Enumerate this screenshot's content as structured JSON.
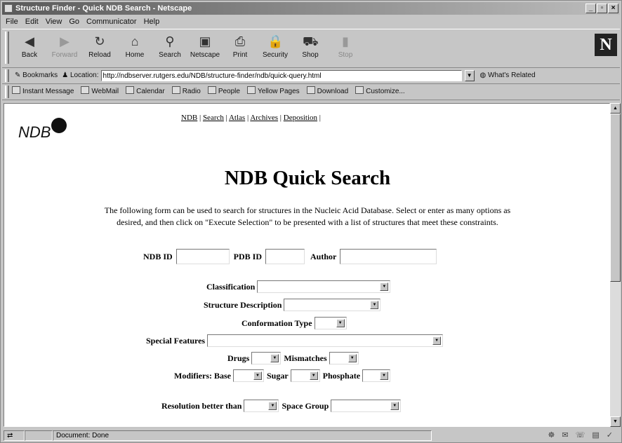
{
  "window": {
    "title": "Structure Finder - Quick NDB Search - Netscape",
    "controls": [
      "_",
      "▫",
      "×"
    ]
  },
  "menu": [
    "File",
    "Edit",
    "View",
    "Go",
    "Communicator",
    "Help"
  ],
  "toolbar": [
    {
      "label": "Back",
      "icon": "back-arrow-icon",
      "glyph": "◀",
      "enabled": true
    },
    {
      "label": "Forward",
      "icon": "forward-arrow-icon",
      "glyph": "▶",
      "enabled": false
    },
    {
      "label": "Reload",
      "icon": "reload-icon",
      "glyph": "↻",
      "enabled": true
    },
    {
      "label": "Home",
      "icon": "home-icon",
      "glyph": "⌂",
      "enabled": true
    },
    {
      "label": "Search",
      "icon": "search-icon",
      "glyph": "⚲",
      "enabled": true
    },
    {
      "label": "Netscape",
      "icon": "netscape-icon",
      "glyph": "▣",
      "enabled": true
    },
    {
      "label": "Print",
      "icon": "print-icon",
      "glyph": "⎙",
      "enabled": true
    },
    {
      "label": "Security",
      "icon": "lock-icon",
      "glyph": "🔒",
      "enabled": true
    },
    {
      "label": "Shop",
      "icon": "shop-icon",
      "glyph": "⛟",
      "enabled": true
    },
    {
      "label": "Stop",
      "icon": "stop-icon",
      "glyph": "▮",
      "enabled": false
    }
  ],
  "brand_logo": "N",
  "location": {
    "bookmarks_label": "Bookmarks",
    "label": "Location:",
    "url": "http://ndbserver.rutgers.edu/NDB/structure-finder/ndb/quick-query.html",
    "related_label": "What's Related"
  },
  "personal_toolbar": [
    "Instant Message",
    "WebMail",
    "Calendar",
    "Radio",
    "People",
    "Yellow Pages",
    "Download",
    "Customize..."
  ],
  "page": {
    "logo_text": "NDB",
    "nav": [
      "NDB",
      "Search",
      "Atlas",
      "Archives",
      "Deposition"
    ],
    "heading": "NDB Quick Search",
    "intro_1": "The following form can be used to search for structures in the Nucleic Acid Database. Select or enter as many options as",
    "intro_2": "desired, and then click on \"Execute Selection\" to be presented with a list of structures that meet these constraints.",
    "fields": {
      "ndb_id": "NDB ID",
      "pdb_id": "PDB ID",
      "author": "Author",
      "classification": "Classification",
      "structure_description": "Structure Description",
      "conformation_type": "Conformation Type",
      "special_features": "Special Features",
      "drugs": "Drugs",
      "mismatches": "Mismatches",
      "modifiers": "Modifiers: Base",
      "sugar": "Sugar",
      "phosphate": "Phosphate",
      "resolution": "Resolution better than",
      "space_group": "Space Group"
    }
  },
  "status": {
    "text": "Document: Done"
  }
}
